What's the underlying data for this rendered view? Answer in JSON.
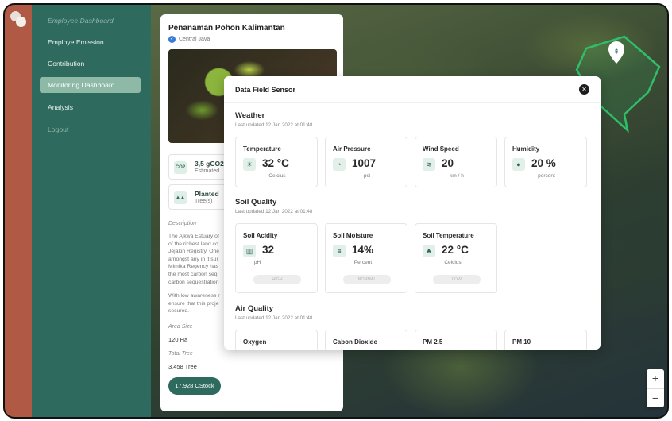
{
  "sidebar": {
    "items": [
      {
        "label": "Employee Dashboard"
      },
      {
        "label": "Employe Emission"
      },
      {
        "label": "Contribution"
      },
      {
        "label": "Monitoring Dashboard"
      },
      {
        "label": "Analysis"
      },
      {
        "label": "Logout"
      }
    ],
    "active_item": "Monitoring Dashboard"
  },
  "project": {
    "title": "Penanaman Pohon Kalimantan",
    "location": "Central Java",
    "stats": [
      {
        "value": "3,5 gCO2",
        "label": "Estimated"
      },
      {
        "value": "Planted",
        "label": "Tree(s)"
      }
    ],
    "description_label": "Description",
    "description_p1": "The Ajkwa Estuary of\nof the richest land co\nJejakin Registry. One\namongst any in it sur\nMimika Regency has\nthe most carbon seq\ncarbon sequestration",
    "description_p2": "With low awareness r\nensure that this proje\nsecured.",
    "area_label": "Area Size",
    "area_value": "120 Ha",
    "tree_label": "Total Tree",
    "tree_value": "3.458 Tree",
    "cstock_button": "17.928 CStock"
  },
  "map": {
    "zoom_in": "+",
    "zoom_out": "−"
  },
  "modal": {
    "title": "Data Field Sensor",
    "close_label": "✕",
    "weather": {
      "title": "Weather",
      "updated": "Last updated 12 Jan 2022 at 01:48",
      "tiles": [
        {
          "title": "Temperature",
          "value": "32 °C",
          "unit": "Celcius",
          "icon": "sun-icon"
        },
        {
          "title": "Air Pressure",
          "value": "1007",
          "unit": "psi",
          "icon": "gauge-icon"
        },
        {
          "title": "Wind Speed",
          "value": "20",
          "unit": "km / h",
          "icon": "wind-icon"
        },
        {
          "title": "Humidity",
          "value": "20 %",
          "unit": "percent",
          "icon": "droplet-icon"
        }
      ]
    },
    "soil": {
      "title": "Soil Quality",
      "updated": "Last updated 12 Jan 2022 at 01:48",
      "tiles": [
        {
          "title": "Soil Acidity",
          "value": "32",
          "unit": "pH",
          "status": "HIGH",
          "icon": "ph-meter-icon"
        },
        {
          "title": "Soil Moisture",
          "value": "14%",
          "unit": "Percent",
          "status": "NORMAL",
          "icon": "moisture-icon"
        },
        {
          "title": "Soil Temperature",
          "value": "22 °C",
          "unit": "Celcius",
          "status": "LOW",
          "icon": "plant-temperature-icon"
        }
      ]
    },
    "air": {
      "title": "Air Quality",
      "updated": "Last updated 12 Jan 2022 at 01:48",
      "tiles": [
        {
          "title": "Oxygen"
        },
        {
          "title": "Cabon Dioxide"
        },
        {
          "title": "PM 2.5"
        },
        {
          "title": "PM 10"
        }
      ]
    }
  },
  "colors": {
    "accent": "#2e6b5e",
    "strip": "#b05a45",
    "sidebar_active": "#8fb9a7",
    "map_polygon": "#2fbf6a"
  }
}
